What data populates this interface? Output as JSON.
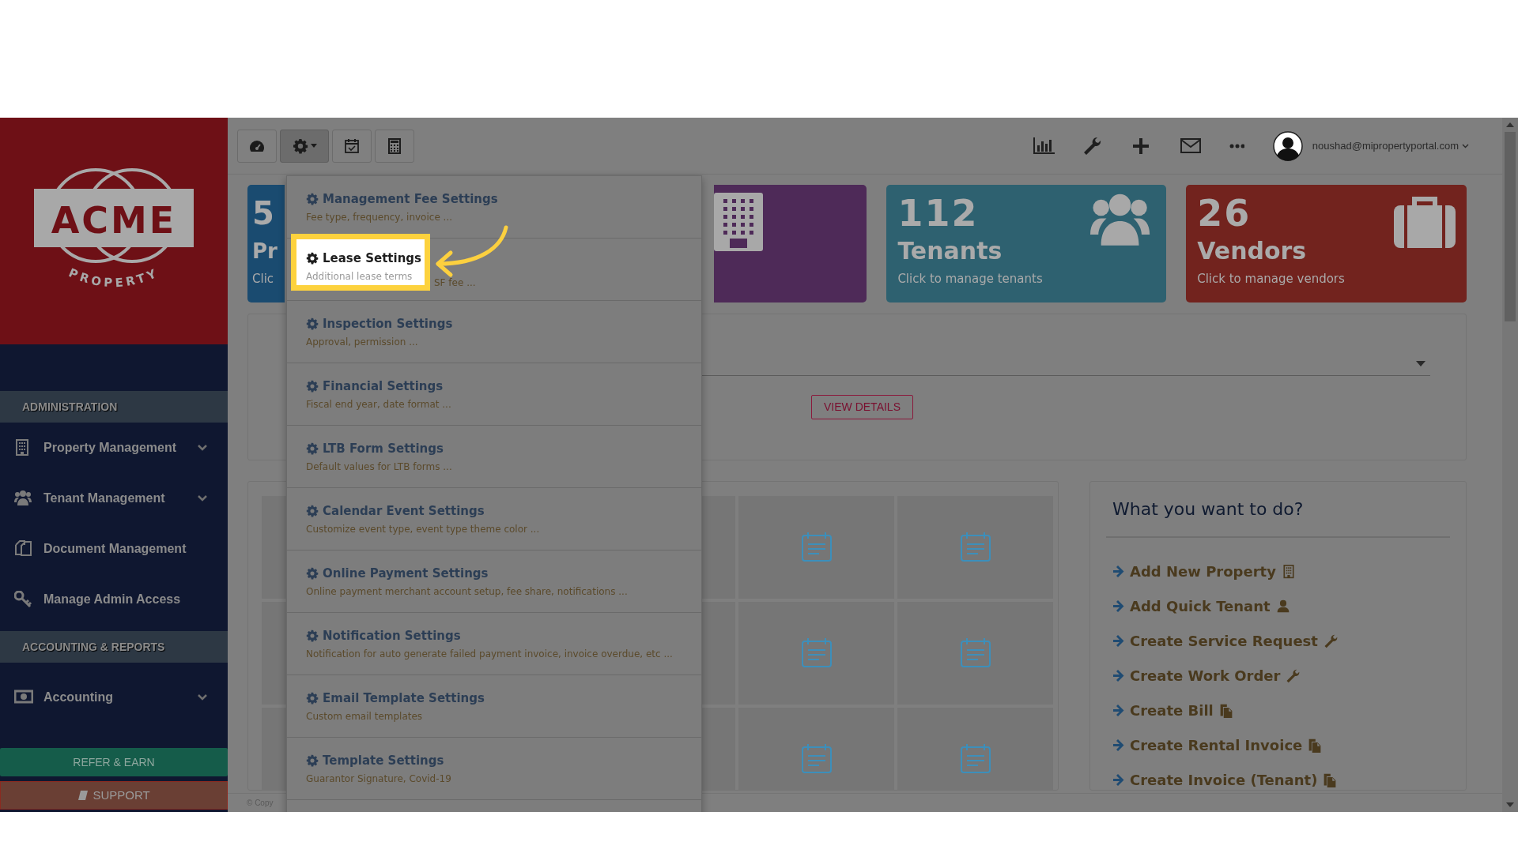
{
  "logo": {
    "name": "ACME",
    "tagline": "PROPERTY"
  },
  "sidebar": {
    "sections": [
      {
        "heading": "ADMINISTRATION",
        "items": [
          {
            "label": "Property Management",
            "expandable": true
          },
          {
            "label": "Tenant Management",
            "expandable": true
          },
          {
            "label": "Document Management",
            "expandable": false
          },
          {
            "label": "Manage Admin Access",
            "expandable": false
          }
        ]
      },
      {
        "heading": "ACCOUNTING & REPORTS",
        "items": [
          {
            "label": "Accounting",
            "expandable": true
          }
        ]
      }
    ],
    "refer_button": "REFER & EARN",
    "support_button": "SUPPORT"
  },
  "toolbar": [
    {
      "selected": false
    },
    {
      "selected": true
    },
    {
      "selected": false
    },
    {
      "selected": false
    }
  ],
  "user_email": "noushad@mipropertyportal.com",
  "stat_cards": [
    {
      "number": "5",
      "label": "Pr",
      "hint": "Clic",
      "color": "#1a4b70"
    },
    {
      "color": "#4e2a58"
    },
    {
      "number": "112",
      "label": "Tenants",
      "hint": "Click to manage tenants",
      "color": "#2e6170"
    },
    {
      "number": "26",
      "label": "Vendors",
      "hint": "Click to manage vendors",
      "color": "#72231e"
    }
  ],
  "view_details_button": "VIEW DETAILS",
  "settings_menu": [
    {
      "title": "Management Fee Settings",
      "subtitle": "Fee type, frequency, invoice ...",
      "highlighted": false
    },
    {
      "title": "Lease Settings",
      "subtitle": "Additional lease terms",
      "subtitle_rest": "SF fee ...",
      "highlighted": true
    },
    {
      "title": "Inspection Settings",
      "subtitle": "Approval, permission ...",
      "highlighted": false
    },
    {
      "title": "Financial Settings",
      "subtitle": "Fiscal end year, date format ...",
      "highlighted": false
    },
    {
      "title": "LTB Form Settings",
      "subtitle": "Default values for LTB forms ...",
      "highlighted": false
    },
    {
      "title": "Calendar Event Settings",
      "subtitle": "Customize event type, event type theme color ...",
      "highlighted": false
    },
    {
      "title": "Online Payment Settings",
      "subtitle": "Online payment merchant account setup, fee share, notifications ...",
      "highlighted": false
    },
    {
      "title": "Notification Settings",
      "subtitle": "Notification for auto generate failed payment invoice, invoice overdue, etc ...",
      "highlighted": false
    },
    {
      "title": "Email Template Settings",
      "subtitle": "Custom email templates",
      "highlighted": false
    },
    {
      "title": "Template Settings",
      "subtitle": "Guarantor Signature, Covid-19",
      "highlighted": false
    }
  ],
  "quick_actions": {
    "title": "What you want to do?",
    "items": [
      "Add New Property",
      "Add Quick Tenant",
      "Create Service Request",
      "Create Work Order",
      "Create Bill",
      "Create Rental Invoice",
      "Create Invoice (Tenant)"
    ]
  },
  "footer": "© Copy"
}
